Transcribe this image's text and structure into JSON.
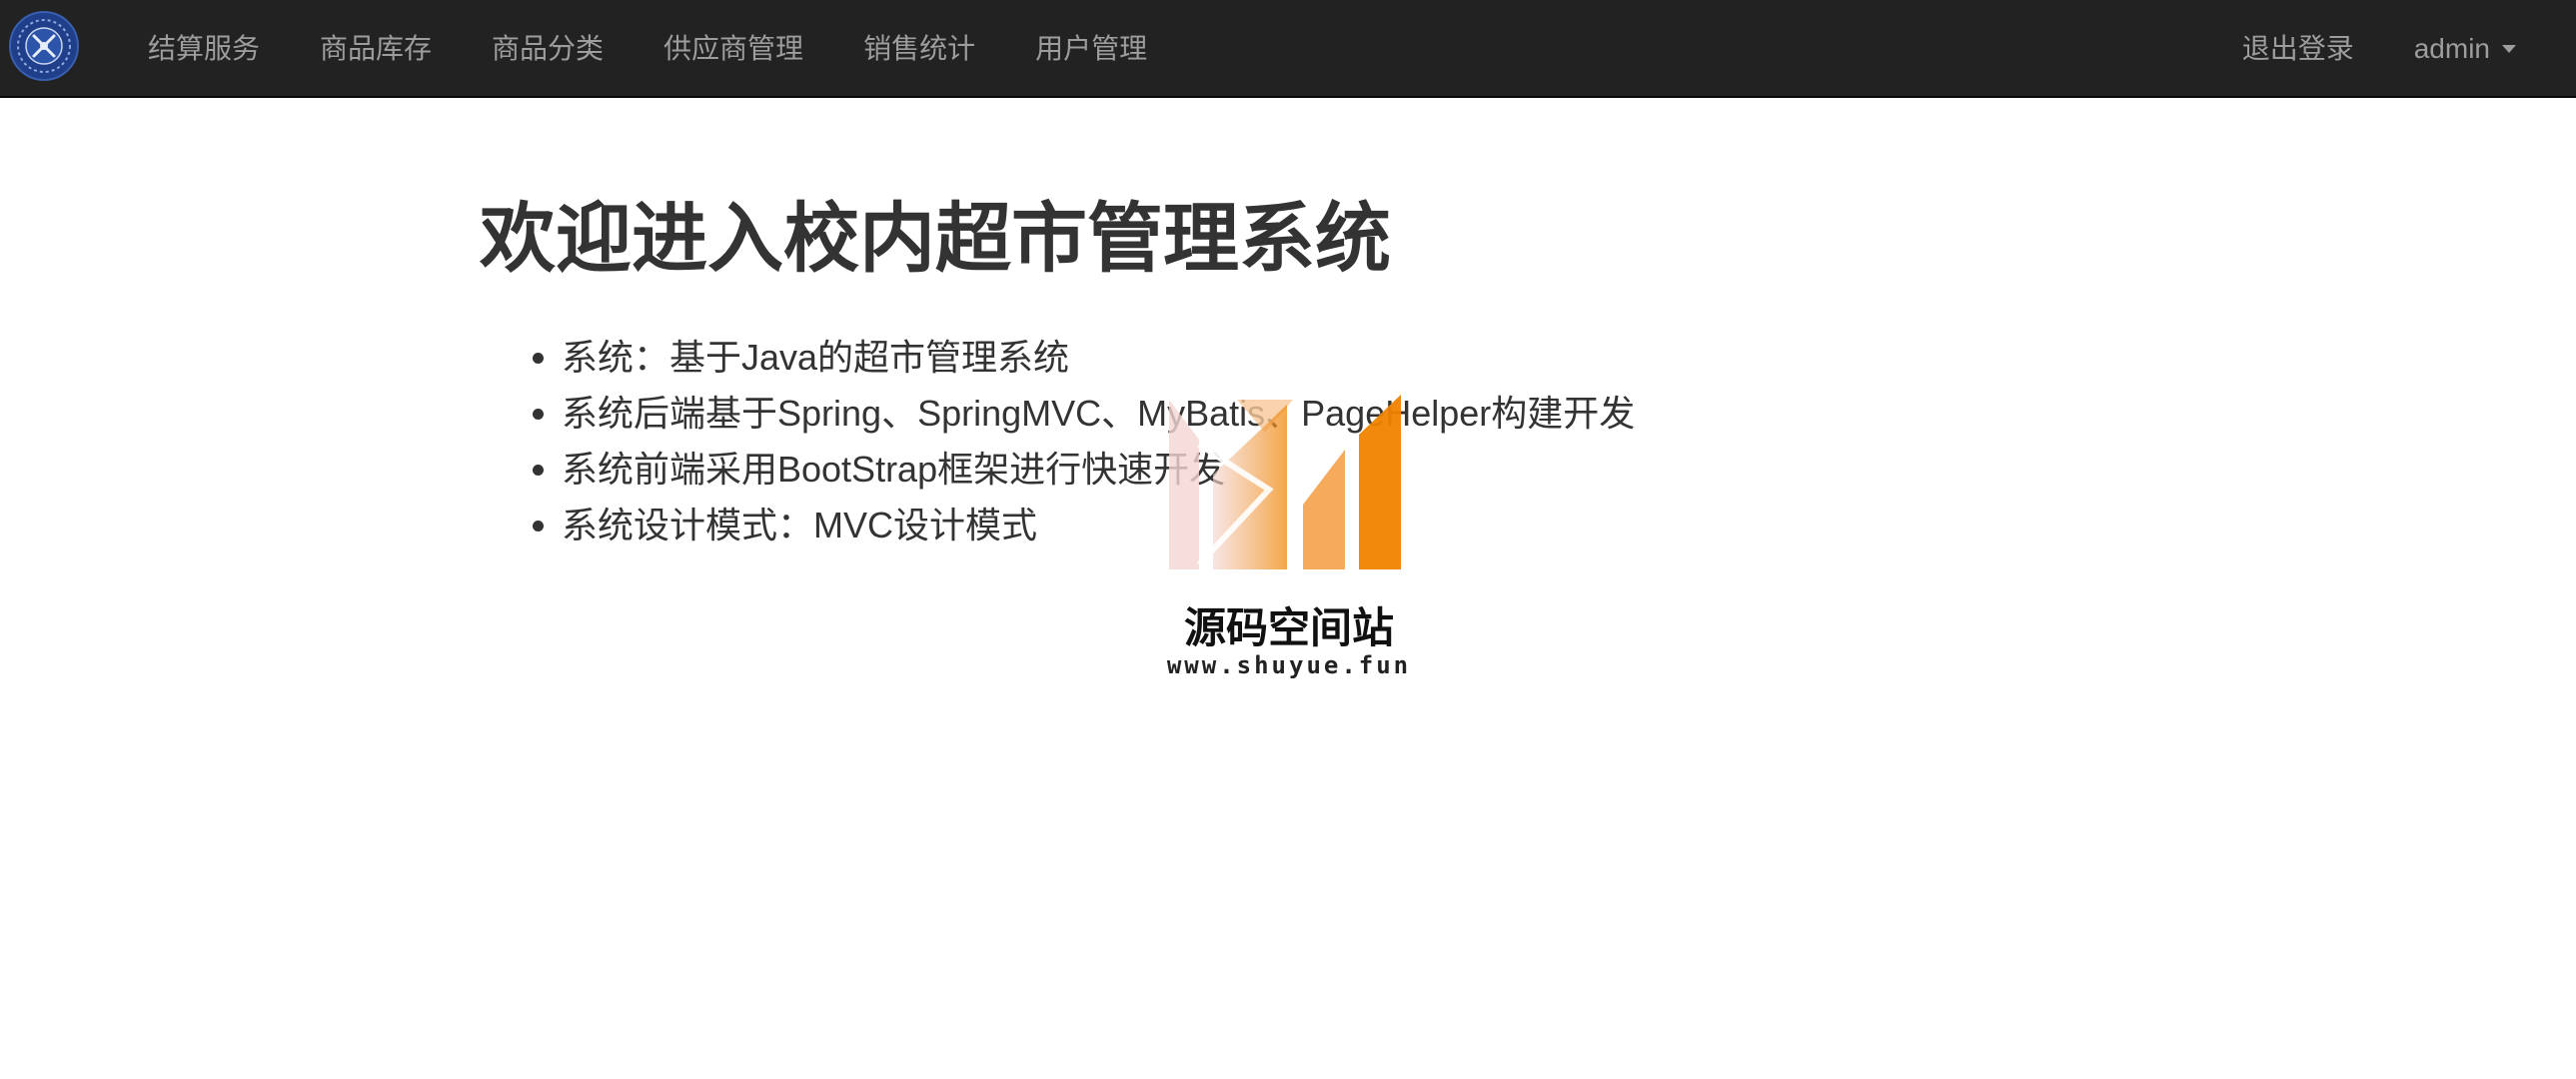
{
  "navbar": {
    "logo_icon": "school-emblem-icon",
    "items": [
      {
        "label": "结算服务"
      },
      {
        "label": "商品库存"
      },
      {
        "label": "商品分类"
      },
      {
        "label": "供应商管理"
      },
      {
        "label": "销售统计"
      },
      {
        "label": "用户管理"
      }
    ],
    "logout_label": "退出登录",
    "user_label": "admin",
    "background": "#222222",
    "text_color": "#9d9d9d"
  },
  "main": {
    "title": "欢迎进入校内超市管理系统",
    "features": [
      "系统：基于Java的超市管理系统",
      "系统后端基于Spring、SpringMVC、MyBatis、PageHelper构建开发",
      "系统前端采用BootStrap框架进行快速开发",
      "系统设计模式：MVC设计模式"
    ]
  },
  "watermark": {
    "title": "源码空间站",
    "url": "www.shuyue.fun",
    "accent": "#f08300"
  }
}
